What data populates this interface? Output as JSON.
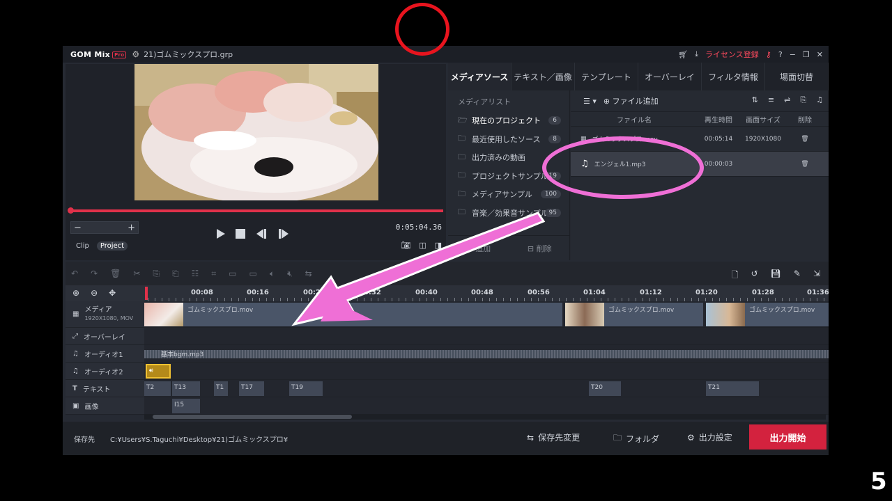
{
  "window": {
    "logo": "GOM Mix",
    "logo_badge": "Pro",
    "file_title": "21)ゴムミックスプロ.grp",
    "license_link": "ライセンス登録",
    "help": "?"
  },
  "preview": {
    "timecode": "0:05:04.36",
    "zoom_minus": "−",
    "zoom_plus": "+",
    "mode_tabs": [
      "Clip",
      "Project"
    ]
  },
  "tabs": [
    "メディアソース",
    "テキスト／画像",
    "テンプレート",
    "オーバーレイ",
    "フィルタ情報",
    "場面切替"
  ],
  "library": {
    "title": "メディアリスト",
    "items": [
      {
        "label": "現在のプロジェクト",
        "count": "6"
      },
      {
        "label": "最近使用したソース",
        "count": "8"
      },
      {
        "label": "出力済みの動画",
        "count": ""
      },
      {
        "label": "プロジェクトサンプル",
        "count": "19"
      },
      {
        "label": "メディアサンプル",
        "count": "100"
      },
      {
        "label": "音楽／効果音サンプル",
        "count": "95"
      }
    ],
    "add_label": "追加",
    "delete_label": "削除"
  },
  "files": {
    "add_file_label": "ファイル追加",
    "headers": {
      "name": "ファイル名",
      "duration": "再生時間",
      "size": "画面サイズ",
      "delete": "削除"
    },
    "rows": [
      {
        "name": "ゴムミックスプロ.mov",
        "duration": "00:05:14",
        "size": "1920X1080"
      },
      {
        "name": "エンジェル1.mp3",
        "duration": "00:00:03",
        "size": ""
      }
    ]
  },
  "ruler": {
    "labels": [
      "00:08",
      "00:16",
      "00:24",
      "00:32",
      "00:40",
      "00:48",
      "00:56",
      "01:04",
      "01:12",
      "01:20",
      "01:28",
      "01:36"
    ]
  },
  "tracks": {
    "media": {
      "label": "メディア",
      "sub": "1920X1080, MOV",
      "clip_name": "ゴムミックスプロ.mov"
    },
    "overlay": {
      "label": "オーバーレイ"
    },
    "audio1": {
      "label": "オーディオ1",
      "clip_name": "基本bgm.mp3"
    },
    "audio2": {
      "label": "オーディオ2"
    },
    "text": {
      "label": "テキスト",
      "clips": [
        "T2",
        "T13",
        "T1",
        "T17",
        "T19",
        "T20",
        "T21"
      ]
    },
    "image": {
      "label": "画像",
      "clips": [
        "I15"
      ]
    }
  },
  "footer": {
    "save_label": "保存先",
    "save_path": "C:¥Users¥S.Taguchi¥Desktop¥21)ゴムミックスプロ¥",
    "change_dest": "保存先変更",
    "folder": "フォルダ",
    "output_settings": "出力設定",
    "start_output": "出力開始"
  },
  "overlay_badge": "5",
  "colors": {
    "accent": "#e0314a",
    "output_button": "#d3223e",
    "annotation_pink": "#ef6fd6",
    "annotation_red": "#e8141e"
  }
}
